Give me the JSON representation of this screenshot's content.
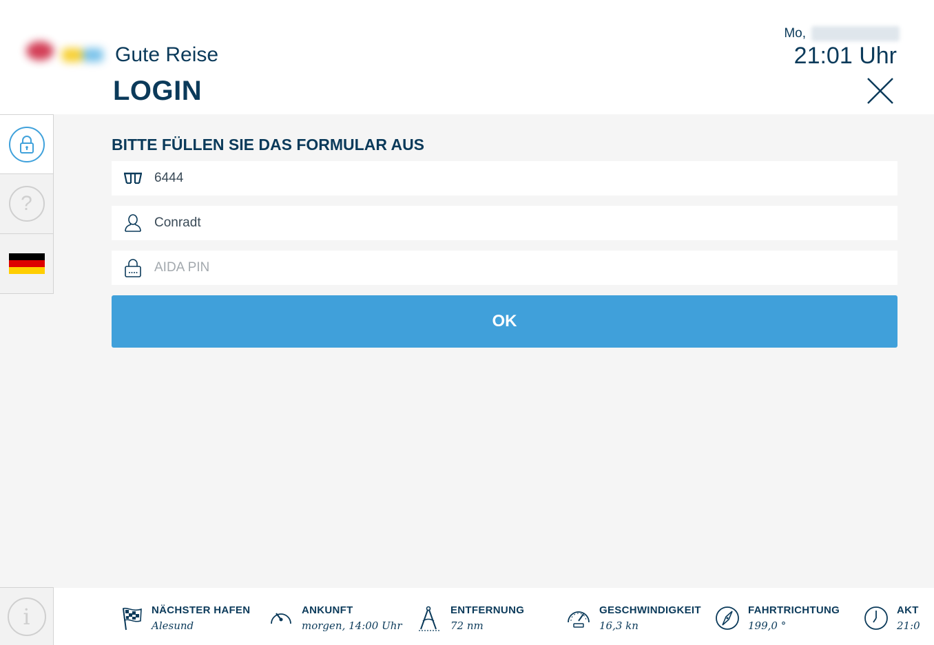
{
  "header": {
    "greeting": "Gute Reise",
    "page_title": "LOGIN",
    "date_prefix": "Mo,",
    "time": "21:01 Uhr"
  },
  "form": {
    "heading": "BITTE FÜLLEN SIE DAS FORMULAR AUS",
    "cabin_value": "6444",
    "name_value": "Conradt",
    "pin_placeholder": "AIDA PIN",
    "ok_label": "OK"
  },
  "sidebar": {
    "help_glyph": "?",
    "info_glyph": "i"
  },
  "footer": {
    "stats": [
      {
        "label": "NÄCHSTER HAFEN",
        "value": "Alesund",
        "icon": "checkered-flag-icon"
      },
      {
        "label": "ANKUNFT",
        "value": "morgen, 14:00 Uhr",
        "icon": "gauge-icon"
      },
      {
        "label": "ENTFERNUNG",
        "value": "72 nm",
        "icon": "compass-divider-icon"
      },
      {
        "label": "GESCHWINDIGKEIT",
        "value": "16,3 kn",
        "icon": "speedometer-icon"
      },
      {
        "label": "FAHRTRICHTUNG",
        "value": "199,0 °",
        "icon": "compass-icon"
      },
      {
        "label": "AKT",
        "value": "21:0",
        "icon": "clock-icon"
      }
    ]
  },
  "colors": {
    "primary": "#0b3a5a",
    "accent": "#40a0da",
    "background": "#f5f5f5"
  }
}
